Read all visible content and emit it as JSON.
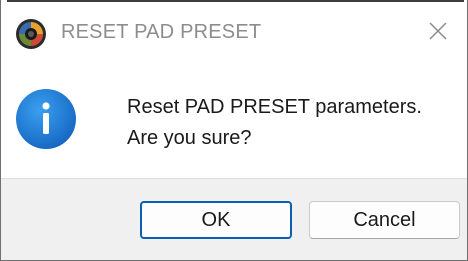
{
  "window": {
    "title": "RESET PAD PRESET",
    "app_icon": "app-logo-icon",
    "close_icon": "close-icon"
  },
  "dialog": {
    "icon": "info-icon",
    "message_line1": "Reset PAD PRESET parameters.",
    "message_line2": "Are you sure?"
  },
  "buttons": {
    "ok_label": "OK",
    "cancel_label": "Cancel"
  },
  "colors": {
    "info_blue": "#1e88e5",
    "focus_border": "#0a5fb4",
    "footer_bg": "#f0f0f0"
  }
}
